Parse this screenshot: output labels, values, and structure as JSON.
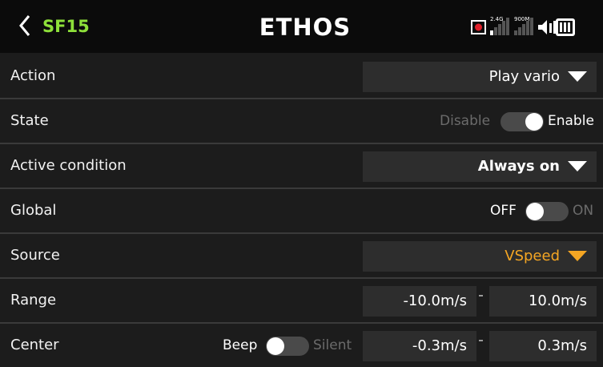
{
  "header": {
    "title": "SF15",
    "logo_text": "ETHOS",
    "signal_label_1": "2.4G",
    "signal_label_2": "900M",
    "icons": [
      "back-chevron-icon",
      "record-icon",
      "signal-bars-icon",
      "speaker-icon",
      "battery-icon"
    ],
    "colors": {
      "title": "#8ee03a",
      "record": "#e0202a"
    }
  },
  "rows": {
    "action": {
      "label": "Action",
      "value": "Play vario"
    },
    "state": {
      "label": "State",
      "off_text": "Disable",
      "on_text": "Enable",
      "is_on": true
    },
    "active_condition": {
      "label": "Active condition",
      "value": "Always on"
    },
    "global": {
      "label": "Global",
      "off_text": "OFF",
      "on_text": "ON",
      "is_on": false
    },
    "source": {
      "label": "Source",
      "value": "VSpeed"
    },
    "range": {
      "label": "Range",
      "min": "-10.0m/s",
      "max": "10.0m/s"
    },
    "center": {
      "label": "Center",
      "left_text": "Beep",
      "right_text": "Silent",
      "is_beep": true,
      "min": "-0.3m/s",
      "max": "0.3m/s"
    }
  },
  "accent_color": "#f5a623"
}
